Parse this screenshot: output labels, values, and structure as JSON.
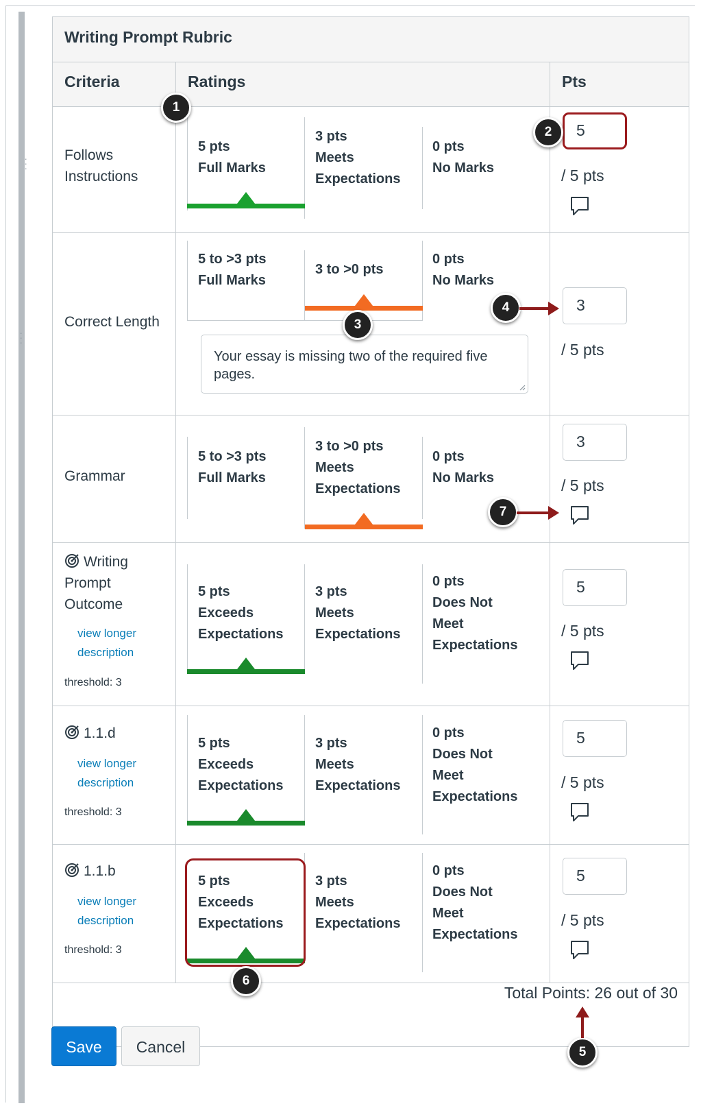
{
  "rubric": {
    "title": "Writing Prompt Rubric",
    "headers": {
      "criteria": "Criteria",
      "ratings": "Ratings",
      "pts": "Pts"
    },
    "rows": [
      {
        "criterion": [
          "Follows",
          "Instructions"
        ],
        "ratings": [
          {
            "pts": "5 pts",
            "desc": [
              "Full Marks"
            ]
          },
          {
            "pts": "3 pts",
            "desc": [
              "Meets",
              "Expectations"
            ]
          },
          {
            "pts": "0 pts",
            "desc": [
              "No Marks"
            ]
          }
        ],
        "points_value": "5",
        "out_of": "/ 5 pts"
      },
      {
        "criterion": [
          "Correct Length"
        ],
        "ratings": [
          {
            "pts": "5 to >3 pts",
            "desc": [
              "Full Marks"
            ]
          },
          {
            "pts": "3 to >0 pts",
            "desc": []
          },
          {
            "pts": "0 pts",
            "desc": [
              "No Marks"
            ]
          }
        ],
        "comment": [
          "Your essay is missing two of the required five",
          "pages."
        ],
        "points_value": "3",
        "out_of": "/ 5 pts"
      },
      {
        "criterion": [
          "Grammar"
        ],
        "ratings": [
          {
            "pts": "5 to >3 pts",
            "desc": [
              "Full Marks"
            ]
          },
          {
            "pts": "3 to >0 pts",
            "desc": [
              "Meets",
              "Expectations"
            ]
          },
          {
            "pts": "0 pts",
            "desc": [
              "No Marks"
            ]
          }
        ],
        "points_value": "3",
        "out_of": "/ 5 pts"
      },
      {
        "criterion": [
          "Writing",
          "Prompt",
          "Outcome"
        ],
        "link": [
          "view longer",
          "description"
        ],
        "threshold": "threshold: 3",
        "ratings": [
          {
            "pts": "5 pts",
            "desc": [
              "Exceeds",
              "Expectations"
            ]
          },
          {
            "pts": "3 pts",
            "desc": [
              "Meets",
              "Expectations"
            ]
          },
          {
            "pts": "0 pts",
            "desc": [
              "Does Not",
              "Meet",
              "Expectations"
            ]
          }
        ],
        "points_value": "5",
        "out_of": "/ 5 pts"
      },
      {
        "criterion": [
          "1.1.d"
        ],
        "link": [
          "view longer",
          "description"
        ],
        "threshold": "threshold: 3",
        "ratings": [
          {
            "pts": "5 pts",
            "desc": [
              "Exceeds",
              "Expectations"
            ]
          },
          {
            "pts": "3 pts",
            "desc": [
              "Meets",
              "Expectations"
            ]
          },
          {
            "pts": "0 pts",
            "desc": [
              "Does Not",
              "Meet",
              "Expectations"
            ]
          }
        ],
        "points_value": "5",
        "out_of": "/ 5 pts"
      },
      {
        "criterion": [
          "1.1.b"
        ],
        "link": [
          "view longer",
          "description"
        ],
        "threshold": "threshold: 3",
        "ratings": [
          {
            "pts": "5 pts",
            "desc": [
              "Exceeds",
              "Expectations"
            ]
          },
          {
            "pts": "3 pts",
            "desc": [
              "Meets",
              "Expectations"
            ]
          },
          {
            "pts": "0 pts",
            "desc": [
              "Does Not",
              "Meet",
              "Expectations"
            ]
          }
        ],
        "points_value": "5",
        "out_of": "/ 5 pts"
      }
    ],
    "total": "Total Points: 26 out of 30"
  },
  "buttons": {
    "save": "Save",
    "cancel": "Cancel"
  },
  "callouts": [
    "1",
    "2",
    "3",
    "4",
    "5",
    "6",
    "7"
  ],
  "colors": {
    "selected_full": "#1aa12f",
    "selected_partial": "#f26b22",
    "selected_outcome": "#1a8a2c",
    "link": "#0a7eb8",
    "save_button": "#0a7ad4",
    "annotation": "#9b1b1e"
  },
  "icons": [
    "target-icon",
    "comment-icon",
    "resize-handle-icon"
  ]
}
